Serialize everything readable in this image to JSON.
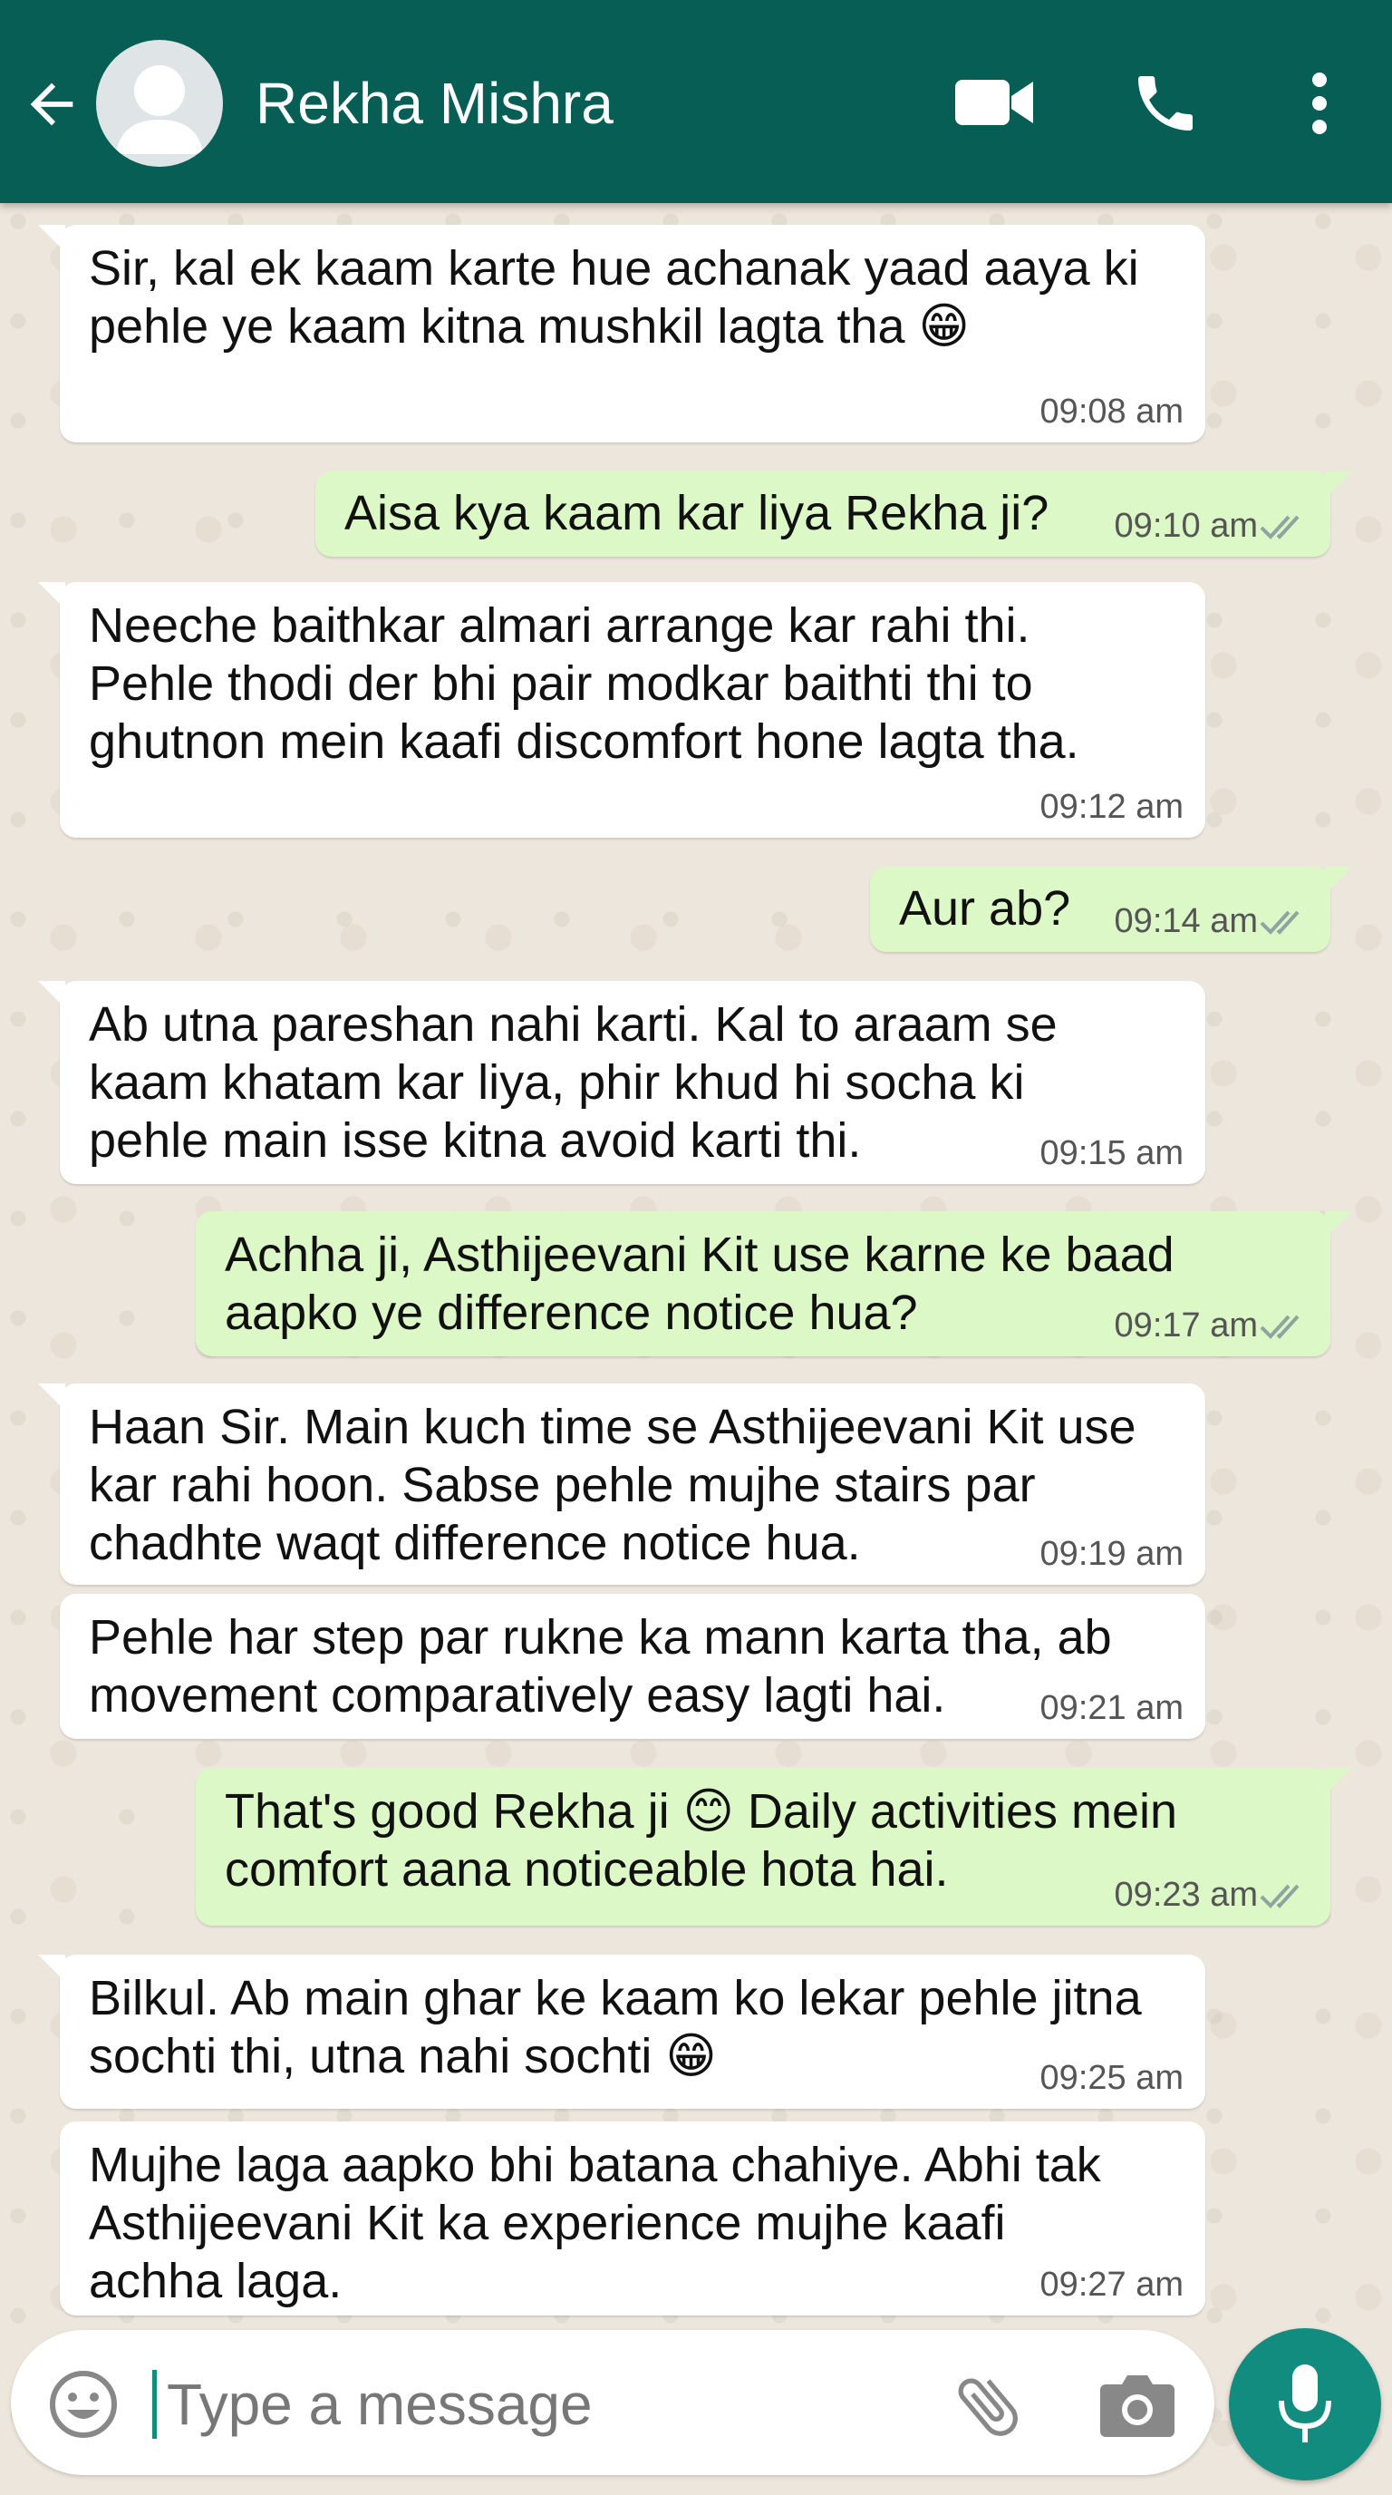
{
  "header": {
    "contact_name": "Rekha Mishra",
    "bg_color": "#075e54"
  },
  "messages": [
    {
      "dir": "in",
      "text": "Sir, kal ek kaam karte hue achanak yaad aaya ki\npehle ye kaam kitna mushkil lagta tha 😁",
      "time": "09:08 am"
    },
    {
      "dir": "out",
      "text": "Aisa kya kaam kar liya Rekha ji?",
      "time": "09:10 am",
      "status": "read"
    },
    {
      "dir": "in",
      "text": "Neeche baithkar almari arrange kar rahi thi.\nPehle thodi der bhi pair modkar baithti thi to\nghutnon mein kaafi discomfort hone lagta tha.",
      "time": "09:12 am"
    },
    {
      "dir": "out",
      "text": "Aur ab?",
      "time": "09:14 am",
      "status": "read"
    },
    {
      "dir": "in",
      "text": "Ab utna pareshan nahi karti. Kal to araam se\nkaam khatam kar liya, phir khud hi socha ki\npehle main isse kitna avoid karti thi.",
      "time": "09:15 am"
    },
    {
      "dir": "out",
      "text": "Achha ji, Asthijeevani Kit use karne ke baad\naapko ye difference notice hua?",
      "time": "09:17 am",
      "status": "read"
    },
    {
      "dir": "in",
      "text": "Haan Sir. Main kuch time se Asthijeevani Kit use\nkar rahi hoon. Sabse pehle mujhe stairs par\nchadhte waqt difference notice hua.",
      "time": "09:19 am"
    },
    {
      "dir": "in",
      "text": "Pehle har step par rukne ka mann karta tha, ab\nmovement comparatively easy lagti hai.",
      "time": "09:21 am"
    },
    {
      "dir": "out",
      "text": "That's good Rekha ji 😊 Daily activities mein\ncomfort aana noticeable hota hai.",
      "time": "09:23 am",
      "status": "read"
    },
    {
      "dir": "in",
      "text": "Bilkul. Ab main ghar ke kaam ko lekar pehle jitna\nsochti thi, utna nahi sochti 😁",
      "time": "09:25 am"
    },
    {
      "dir": "in",
      "text": "Mujhe laga aapko bhi batana chahiye. Abhi tak\nAsthijeevani Kit ka experience mujhe kaafi\nachha laga.",
      "time": "09:27 am"
    }
  ],
  "composer": {
    "placeholder": "Type a message"
  },
  "colors": {
    "incoming_bubble": "#ffffff",
    "outgoing_bubble": "#dcf8c6",
    "accent": "#128c7e"
  }
}
